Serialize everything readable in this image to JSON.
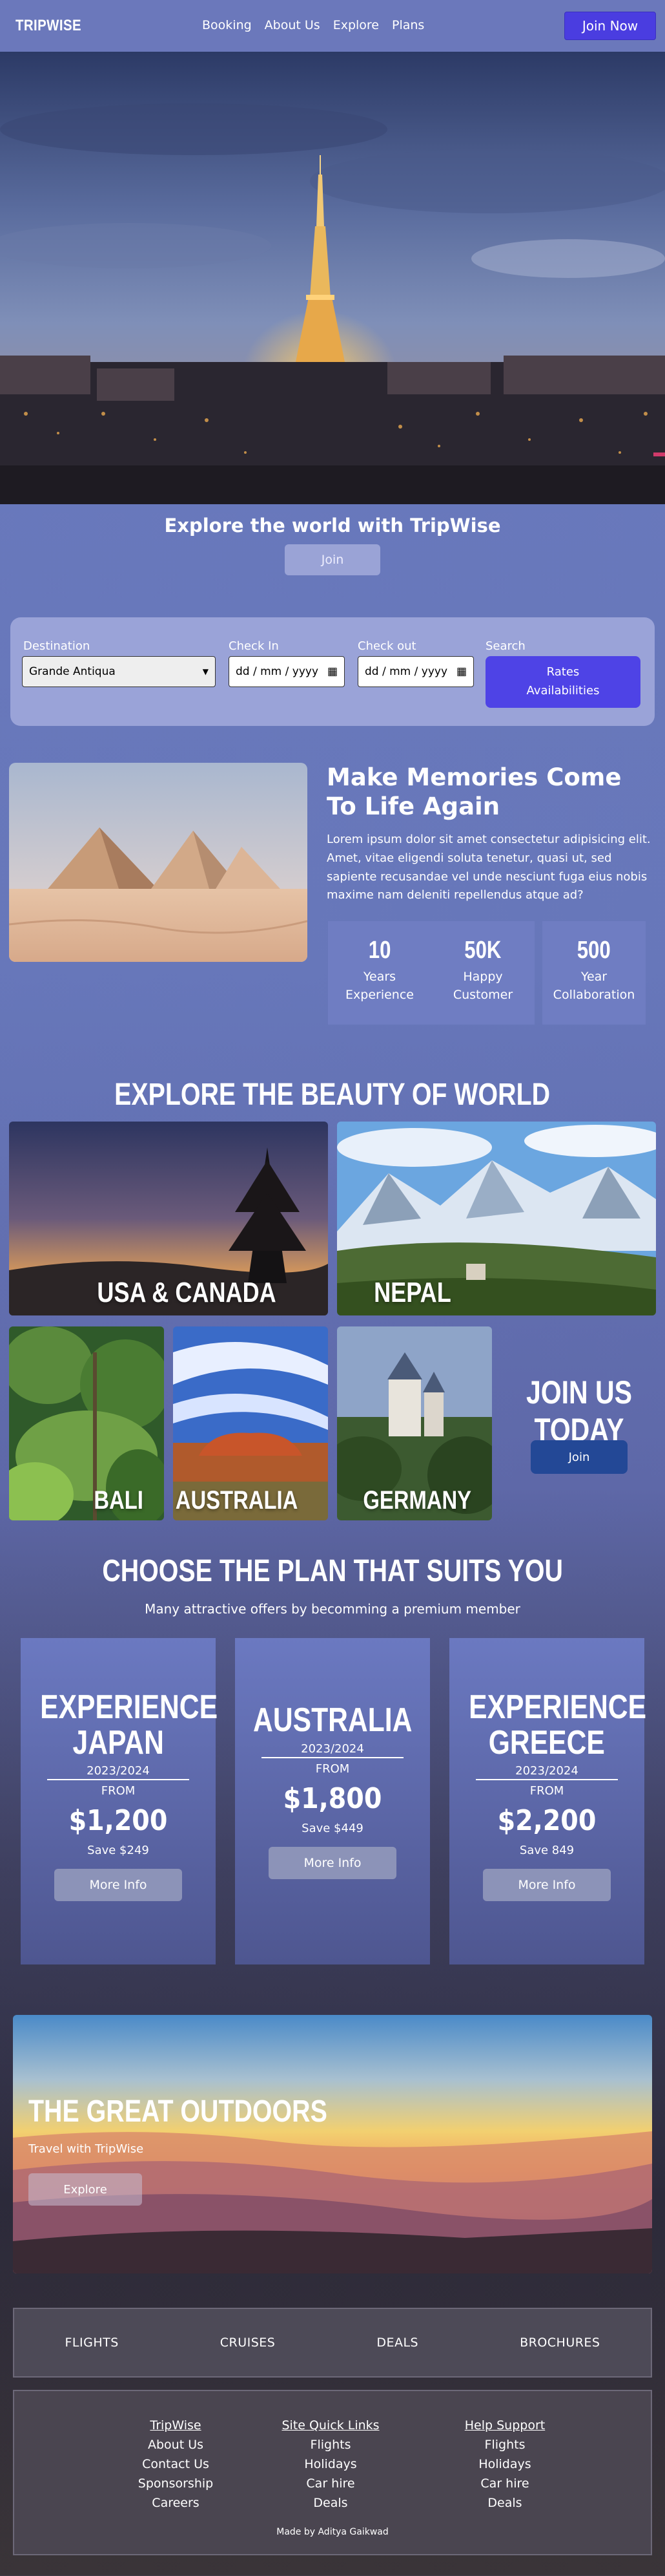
{
  "nav": {
    "logo": "TRIPWISE",
    "links": [
      "Booking",
      "About Us",
      "Explore",
      "Plans"
    ],
    "cta": "Join Now"
  },
  "hero": {
    "title": "Explore the world with TripWise",
    "button": "Join"
  },
  "booking": {
    "destination_label": "Destination",
    "destination_value": "Grande Antiqua",
    "checkin_label": "Check In",
    "checkin_placeholder": "dd / mm / yyyy",
    "checkout_label": "Check out",
    "checkout_placeholder": "dd / mm / yyyy",
    "search_label": "Search",
    "search_button_line1": "Rates",
    "search_button_line2": "Availabilities"
  },
  "about": {
    "title": "Make Memories Come To Life Again",
    "text": "Lorem ipsum dolor sit amet consectetur adipisicing elit. Amet, vitae eligendi soluta tenetur, quasi ut, sed sapiente recusandae vel unde nesciunt fuga eius nobis maxime nam deleniti repellendus atque ad?",
    "stats": [
      {
        "number": "10",
        "line1": "Years",
        "line2": "Experience"
      },
      {
        "number": "50K",
        "line1": "Happy",
        "line2": "Customer"
      },
      {
        "number": "500",
        "line1": "Year",
        "line2": "Collaboration"
      }
    ]
  },
  "explore": {
    "title": "EXPLORE THE BEAUTY OF WORLD",
    "destinations": [
      "USA & CANADA",
      "NEPAL",
      "BALI",
      "AUSTRALIA",
      "GERMANY"
    ],
    "join_title": "JOIN US TODAY",
    "join_button": "Join"
  },
  "plans": {
    "title": "CHOOSE THE PLAN THAT SUITS YOU",
    "subtitle": "Many attractive offers by becomming a premium member",
    "items": [
      {
        "name1": "EXPERIENCE",
        "name2": "JAPAN",
        "year": "2023/2024",
        "from": "FROM",
        "price": "$1,200",
        "save": "Save $249",
        "button": "More Info"
      },
      {
        "name1": "AUSTRALIA",
        "name2": "",
        "year": "2023/2024",
        "from": "FROM",
        "price": "$1,800",
        "save": "Save $449",
        "button": "More Info"
      },
      {
        "name1": "EXPERIENCE",
        "name2": "GREECE",
        "year": "2023/2024",
        "from": "FROM",
        "price": "$2,200",
        "save": "Save 849",
        "button": "More Info"
      }
    ]
  },
  "outdoors": {
    "title": "THE GREAT OUTDOORS",
    "subtitle": "Travel with TripWise",
    "button": "Explore"
  },
  "categories": [
    "FLIGHTS",
    "CRUISES",
    "DEALS",
    "BROCHURES"
  ],
  "footer": {
    "columns": [
      {
        "heading": "TripWise",
        "items": [
          "About Us",
          "Contact Us",
          "Sponsorship",
          "Careers"
        ]
      },
      {
        "heading": "Site Quick Links",
        "items": [
          "Flights",
          "Holidays",
          "Car hire",
          "Deals"
        ]
      },
      {
        "heading": "Help Support",
        "items": [
          "Flights",
          "Holidays",
          "Car hire",
          "Deals"
        ]
      }
    ],
    "credit": "Made by Aditya Gaikwad"
  },
  "colors": {
    "accent": "#4a3de0",
    "nav_bg": "#6b78bb",
    "join_today_button": "#234896"
  }
}
